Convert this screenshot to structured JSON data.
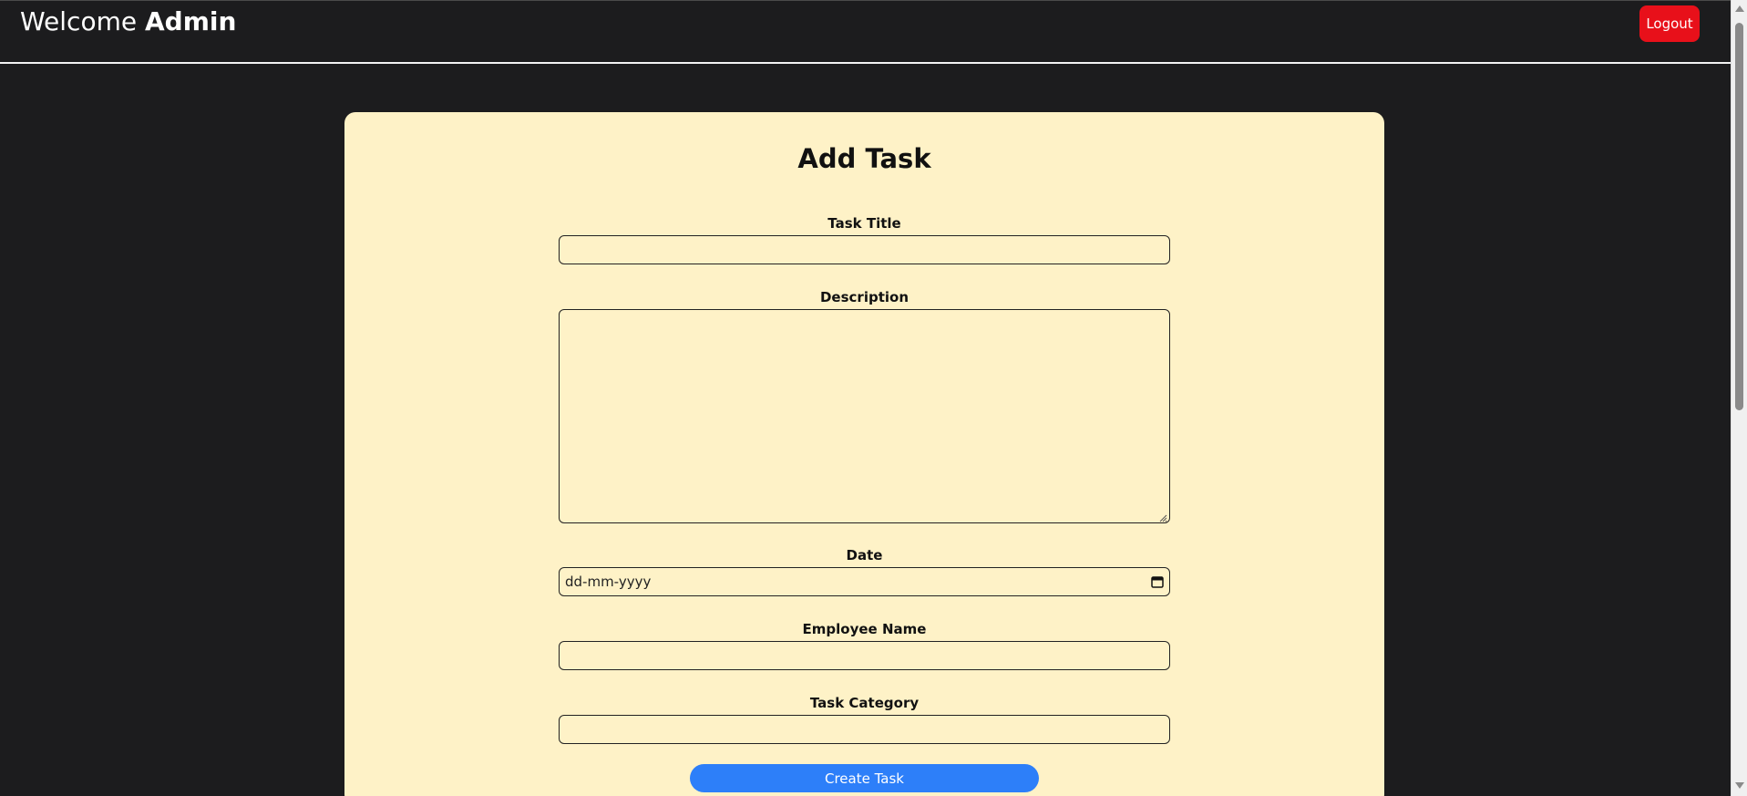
{
  "header": {
    "welcome_prefix": "Welcome",
    "welcome_user": "Admin",
    "logout_label": "Logout"
  },
  "form": {
    "title": "Add Task",
    "fields": [
      {
        "label": "Task Title",
        "value": ""
      },
      {
        "label": "Description",
        "value": ""
      },
      {
        "label": "Date",
        "placeholder": "dd-mm-yyyy"
      },
      {
        "label": "Employee Name",
        "value": ""
      },
      {
        "label": "Task Category",
        "value": ""
      }
    ],
    "submit_label": "Create Task"
  },
  "colors": {
    "background": "#1c1c1e",
    "card": "#fef2c7",
    "logout": "#e8101a",
    "submit": "#2d7ff9"
  },
  "icons": {
    "date": "calendar-icon",
    "textarea": "resize-grip-icon"
  }
}
